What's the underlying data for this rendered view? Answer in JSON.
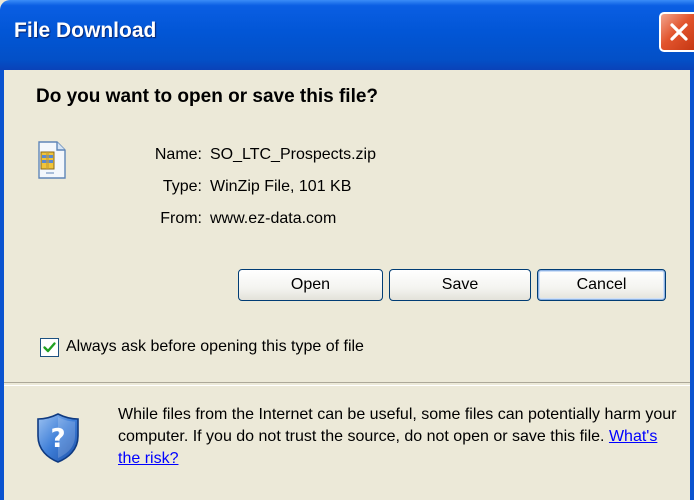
{
  "window": {
    "title": "File Download",
    "close_icon": "close-icon"
  },
  "dialog": {
    "question": "Do you want to open or save this file?",
    "file_icon": "zip-file-icon",
    "name_label": "Name:",
    "name_value": "SO_LTC_Prospects.zip",
    "type_label": "Type:",
    "type_value": "WinZip File, 101 KB",
    "from_label": "From:",
    "from_value": "www.ez-data.com"
  },
  "buttons": {
    "open": "Open",
    "save": "Save",
    "cancel": "Cancel"
  },
  "checkbox": {
    "checked": true,
    "label": "Always ask before opening this type of file"
  },
  "warning": {
    "icon": "shield-help-icon",
    "text": "While files from the Internet can be useful, some files can potentially harm your computer. If you do not trust the source, do not open or save this file.",
    "link": "What's the risk?"
  },
  "colors": {
    "titlebar": "#0256d6",
    "dialog_bg": "#ece9d8",
    "close_button": "#e2542d",
    "link": "#0000ff"
  }
}
